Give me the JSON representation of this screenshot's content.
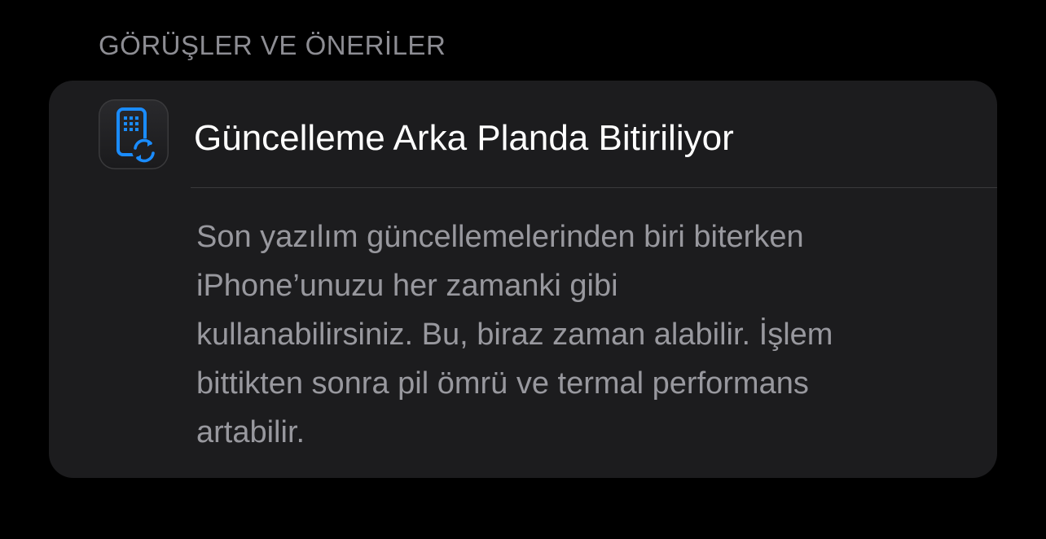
{
  "section": {
    "header": "GÖRÜŞLER VE ÖNERİLER"
  },
  "tip": {
    "icon": "iphone-sync-icon",
    "title": "Güncelleme Arka Planda Bitiriliyor",
    "body": "Son yazılım güncellemelerinden biri biterken\niPhone’unuzu her zamanki gibi\nkullanabilirsiniz. Bu, biraz zaman alabilir. İşlem\nbittikten sonra pil ömrü ve termal performans\nartabilir."
  },
  "colors": {
    "background": "#000000",
    "card": "#1c1c1e",
    "accent": "#1a8cff",
    "header_text": "#8d8d93",
    "body_text": "#98989e"
  }
}
